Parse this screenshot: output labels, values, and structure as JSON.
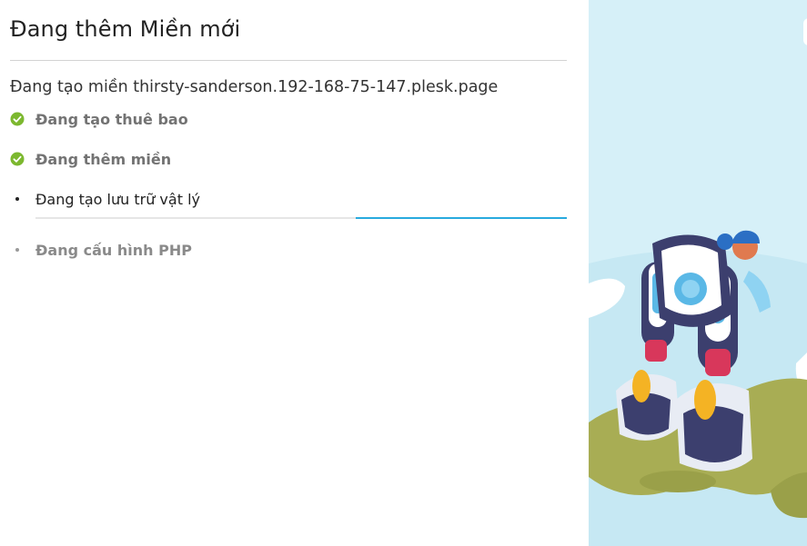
{
  "dialog": {
    "title": "Đang thêm Miền mới",
    "subtitle": "Đang tạo miền thirsty-sanderson.192-168-75-147.plesk.page"
  },
  "steps": [
    {
      "label": "Đang tạo thuê bao",
      "status": "done",
      "icon": "check-circle-icon"
    },
    {
      "label": "Đang thêm miền",
      "status": "done",
      "icon": "check-circle-icon"
    },
    {
      "label": "Đang tạo lưu trữ vật lý",
      "status": "in-progress",
      "icon": "bullet-icon"
    },
    {
      "label": "Đang cấu hình PHP",
      "status": "pending",
      "icon": "bullet-icon"
    }
  ],
  "progress": {
    "state": "indeterminate",
    "bar_color": "#28aade"
  },
  "colors": {
    "done": "#7cb82f",
    "accent": "#28aade",
    "illustration_bg": "#d6f0f8"
  }
}
